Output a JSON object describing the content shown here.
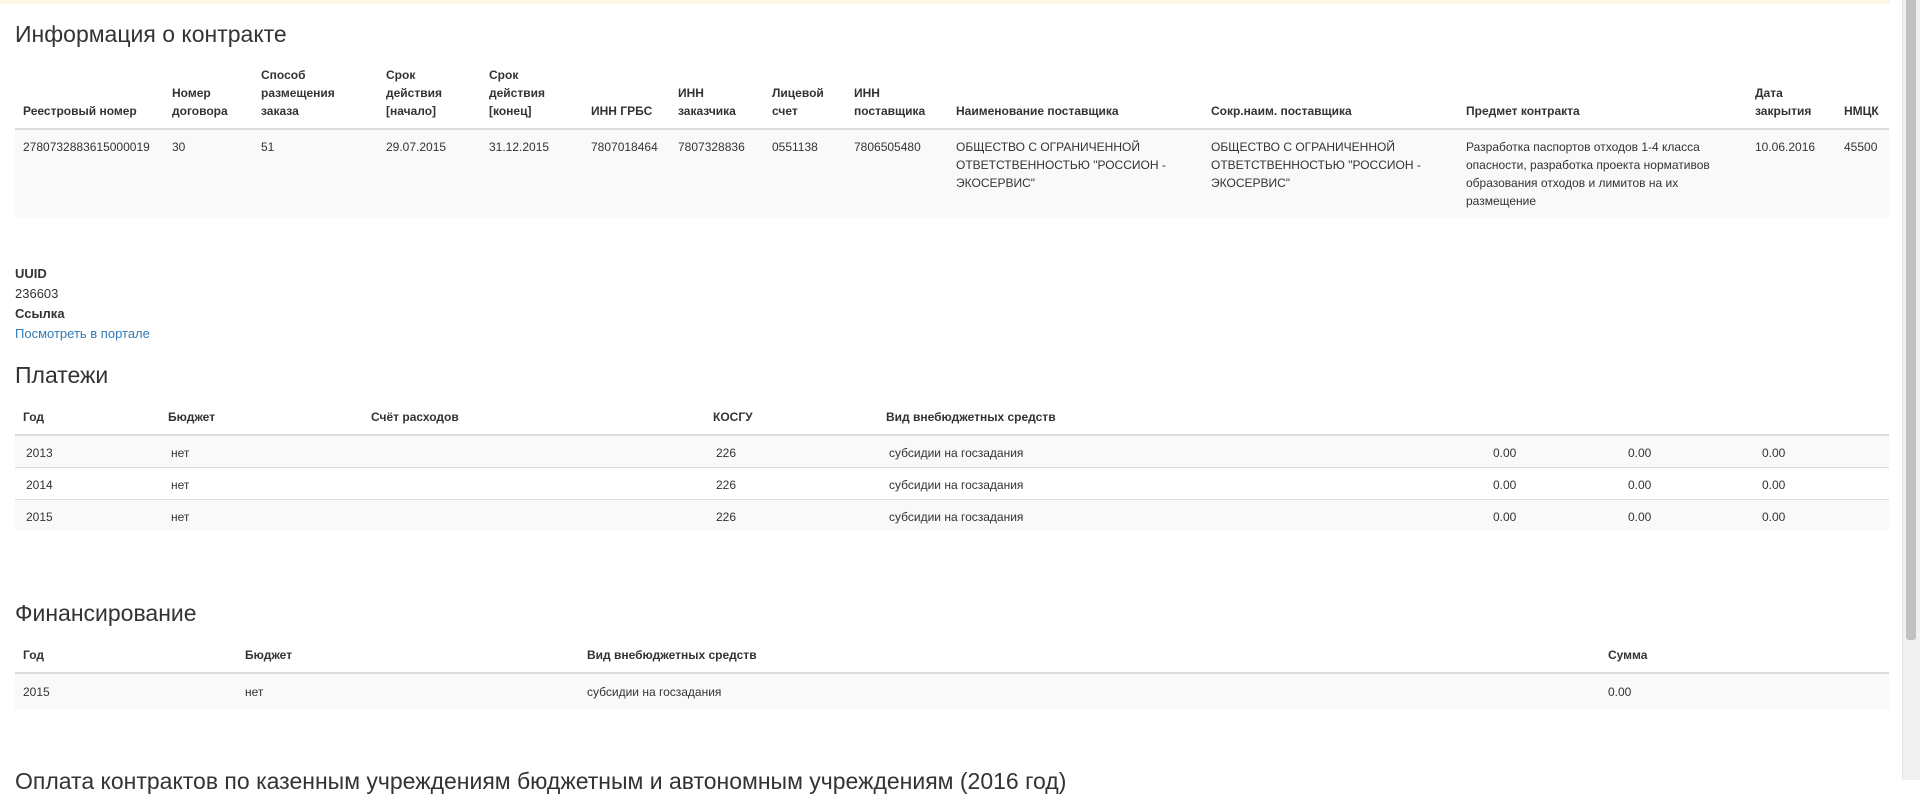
{
  "contract": {
    "title": "Информация о контракте",
    "headers": [
      "Реестровый номер",
      "Номер договора",
      "Способ размещения заказа",
      "Срок действия [начало]",
      "Срок действия [конец]",
      "ИНН ГРБС",
      "ИНН заказчика",
      "Лицевой счет",
      "ИНН поставщика",
      "Наименование поставщика",
      "Сокр.наим. поставщика",
      "Предмет контракта",
      "Дата закрытия",
      "НМЦК"
    ],
    "row": [
      "2780732883615000019",
      "30",
      "51",
      "29.07.2015",
      "31.12.2015",
      "7807018464",
      "7807328836",
      "0551138",
      "7806505480",
      "ОБЩЕСТВО С ОГРАНИЧЕННОЙ ОТВЕТСТВЕННОСТЬЮ \"РОССИОН - ЭКОСЕРВИС\"",
      "ОБЩЕСТВО С ОГРАНИЧЕННОЙ ОТВЕТСТВЕННОСТЬЮ \"РОССИОН - ЭКОСЕРВИС\"",
      "Разработка паспортов отходов 1-4 класса опасности, разработка проекта нормативов образования отходов и лимитов на их размещение",
      "10.06.2016",
      "45500"
    ]
  },
  "meta": {
    "uuid_label": "UUID",
    "uuid_value": "236603",
    "link_label": "Ссылка",
    "link_text": "Посмотреть в портале"
  },
  "payments": {
    "title": "Платежи",
    "headers": [
      "Год",
      "Бюджет",
      "Счёт расходов",
      "КОСГУ",
      "Вид внебюджетных средств",
      "",
      "",
      ""
    ],
    "rows": [
      [
        "2013",
        "нет",
        "",
        "226",
        "субсидии на госзадания",
        "0.00",
        "0.00",
        "0.00"
      ],
      [
        "2014",
        "нет",
        "",
        "226",
        "субсидии на госзадания",
        "0.00",
        "0.00",
        "0.00"
      ],
      [
        "2015",
        "нет",
        "",
        "226",
        "субсидии на госзадания",
        "0.00",
        "0.00",
        "0.00"
      ]
    ]
  },
  "funding": {
    "title": "Финансирование",
    "headers": [
      "Год",
      "Бюджет",
      "Вид внебюджетных средств",
      "Сумма"
    ],
    "rows": [
      [
        "2015",
        "нет",
        "субсидии на госзадания",
        "0.00"
      ]
    ]
  },
  "next_section": {
    "title": "Оплата контрактов по казенным учреждениям бюджетным и автономным учреждениям (2016 год)"
  }
}
